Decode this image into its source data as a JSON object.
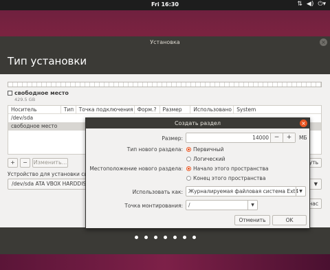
{
  "topbar": {
    "clock": "Fri 16:30"
  },
  "window": {
    "title": "Установка",
    "header": "Тип установки",
    "free_label": "свободное место",
    "free_size": "429.5 GB",
    "columns": [
      "Носитель",
      "Тип",
      "Точка подключения",
      "Форм.?",
      "Размер",
      "Использовано",
      "System"
    ],
    "rows": [
      "/dev/sda",
      "свободное место"
    ],
    "add_btn": "+",
    "remove_btn": "−",
    "change_btn": "Изменить...",
    "revert_btn": "нуть",
    "boot_label": "Устройство для установки си",
    "boot_device": "/dev/sda ATA VBOX HARDDIS",
    "back_btn": "нас"
  },
  "dialog": {
    "title": "Создать раздел",
    "size_label": "Размер:",
    "size_value": "14000",
    "size_unit": "МБ",
    "type_label": "Тип нового раздела:",
    "type_primary": "Первичный",
    "type_logical": "Логический",
    "location_label": "Местоположение нового раздела:",
    "location_start": "Начало этого пространства",
    "location_end": "Конец этого пространства",
    "use_as_label": "Использовать как:",
    "use_as_value": "Журналируемая файловая система Ext4",
    "mount_label": "Точка монтирования:",
    "mount_value": "/",
    "cancel_btn": "Отменить",
    "ok_btn": "OK"
  },
  "colors": {
    "accent": "#e95420",
    "titlebar": "#3b3a36"
  }
}
